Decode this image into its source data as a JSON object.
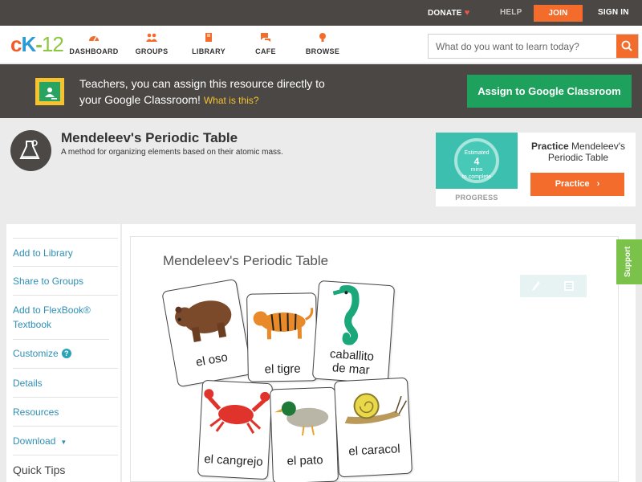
{
  "topbar": {
    "donate": "DONATE",
    "help": "HELP",
    "join": "JOIN",
    "signin": "SIGN IN"
  },
  "nav": {
    "logo_c": "c",
    "logo_k": "K",
    "logo_dash": "-",
    "logo_num": "12",
    "items": [
      {
        "label": "DASHBOARD",
        "icon": "dashboard-icon"
      },
      {
        "label": "GROUPS",
        "icon": "groups-icon"
      },
      {
        "label": "LIBRARY",
        "icon": "library-icon"
      },
      {
        "label": "CAFE",
        "icon": "cafe-icon"
      },
      {
        "label": "BROWSE",
        "icon": "browse-icon"
      }
    ],
    "search_placeholder": "What do you want to learn today?"
  },
  "banner": {
    "line1": "Teachers, you can assign this resource directly to",
    "line2": "your Google Classroom!",
    "what": "What is this?",
    "assign_button": "Assign to Google Classroom"
  },
  "header": {
    "title": "Mendeleev's Periodic Table",
    "subtitle": "A method for organizing elements based on their atomic mass."
  },
  "practice": {
    "estimated": "Estimated",
    "mins": "4",
    "mins_label": "mins",
    "to_complete": "to complete",
    "progress_label": "PROGRESS",
    "prefix": "Practice",
    "name": "Mendeleev's Periodic Table",
    "button": "Practice"
  },
  "sidebar": {
    "items": [
      {
        "label": "Add to Library"
      },
      {
        "label": "Share to Groups"
      },
      {
        "label": "Add to FlexBook® Textbook"
      },
      {
        "label": "Customize"
      },
      {
        "label": "Details"
      },
      {
        "label": "Resources"
      },
      {
        "label": "Download"
      }
    ],
    "help_badge": "?",
    "quick_tips": "Quick Tips"
  },
  "content": {
    "title": "Mendeleev's Periodic Table",
    "cards": [
      {
        "word": "el oso"
      },
      {
        "word": "el tigre"
      },
      {
        "word_line1": "caballito",
        "word_line2": "de mar"
      },
      {
        "word": "el cangrejo"
      },
      {
        "word": "el pato"
      },
      {
        "word": "el caracol"
      }
    ]
  },
  "support": "Support",
  "colors": {
    "accent": "#f36c2b",
    "dark_bar": "#4a4745",
    "google_green": "#1ea15d",
    "link": "#2f8fb5",
    "support_green": "#7bc24a"
  }
}
